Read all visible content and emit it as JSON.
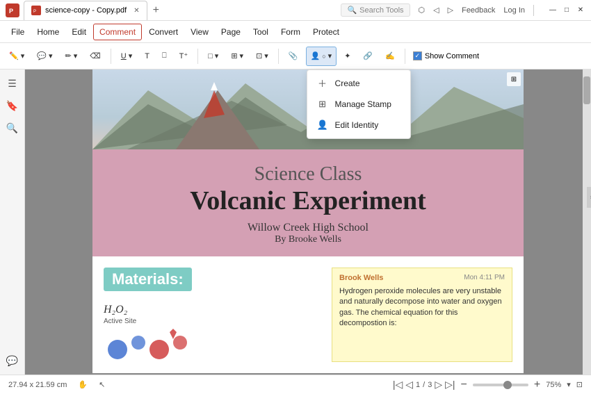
{
  "titlebar": {
    "tab_label": "science-copy - Copy.pdf",
    "tab_icon": "pdf",
    "feedback_label": "Feedback",
    "login_label": "Log In"
  },
  "menubar": {
    "items": [
      "File",
      "Home",
      "Edit",
      "Comment",
      "Convert",
      "View",
      "Page",
      "Tool",
      "Form",
      "Protect"
    ]
  },
  "toolbar": {
    "show_comment_label": "Show Comment",
    "search_placeholder": "Search Tools"
  },
  "dropdown": {
    "items": [
      {
        "label": "Create",
        "icon": "plus"
      },
      {
        "label": "Manage Stamp",
        "icon": "grid"
      },
      {
        "label": "Edit Identity",
        "icon": "person"
      }
    ]
  },
  "pdf": {
    "title_top": "Science Class",
    "title_main": "Volcanic Experiment",
    "subtitle": "Willow Creek High School",
    "author": "By Brooke Wells",
    "materials_label": "Materials:",
    "formula": "H₂O₂",
    "active_site": "Active Site",
    "comment": {
      "author": "Brook Wells",
      "time": "Mon 4:11 PM",
      "text": "Hydrogen peroxide molecules are very unstable and naturally decompose into water and oxygen gas. The chemical equation for this decompostion is:"
    }
  },
  "statusbar": {
    "dimensions": "27.94 x 21.59 cm",
    "page_current": "1",
    "page_total": "3",
    "zoom_value": "75%"
  }
}
